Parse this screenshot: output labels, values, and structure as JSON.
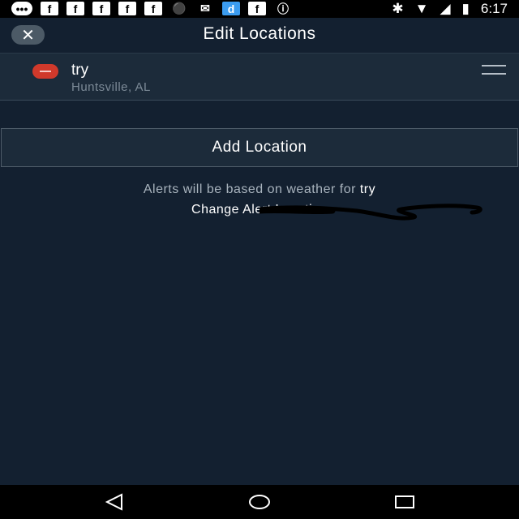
{
  "status_bar": {
    "icons": [
      "message-icon",
      "facebook-icon",
      "facebook-icon",
      "facebook-icon",
      "facebook-icon",
      "facebook-icon",
      "lock-icon",
      "mail-icon",
      "dash-icon",
      "facebook-icon",
      "info-icon"
    ],
    "time": "6:17"
  },
  "header": {
    "title": "Edit Locations",
    "close_icon": "close-icon"
  },
  "locations": [
    {
      "name": "try",
      "subtitle": "Huntsville, AL"
    }
  ],
  "add_location_label": "Add Location",
  "alerts": {
    "prefix": "Alerts will be based on weather for ",
    "location": "try",
    "change_link": "Change Alert Location"
  },
  "colors": {
    "background": "#132030",
    "remove": "#d0392b"
  }
}
